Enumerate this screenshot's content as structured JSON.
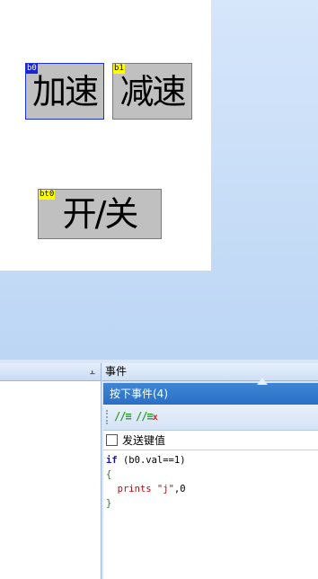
{
  "canvas": {
    "buttons": [
      {
        "id_tag": "b0",
        "label": "加速"
      },
      {
        "id_tag": "b1",
        "label": "减速"
      },
      {
        "id_tag": "bt0",
        "label": "开/关"
      }
    ]
  },
  "panels": {
    "left": {
      "pin_glyph": "⫠"
    },
    "right": {
      "title": "事件",
      "event_tab": "按下事件(4)",
      "toolbar": {
        "comment_icon": "//≡",
        "uncomment_icon": "//≡",
        "uncomment_x": "x"
      },
      "send_key_label": "发送键值",
      "code": {
        "line1_kw": "if",
        "line1_rest": "(b0.val==1)",
        "line2": "{",
        "line3_fn": "prints",
        "line3_str": "\"j\"",
        "line3_rest": ",0",
        "line4": "}"
      }
    }
  },
  "colors": {
    "selected_border": "#1d2fd6",
    "tag_blue": "#1a23d8",
    "tag_yellow": "#ffff00",
    "event_tab_bg": "#2a6fc4"
  }
}
